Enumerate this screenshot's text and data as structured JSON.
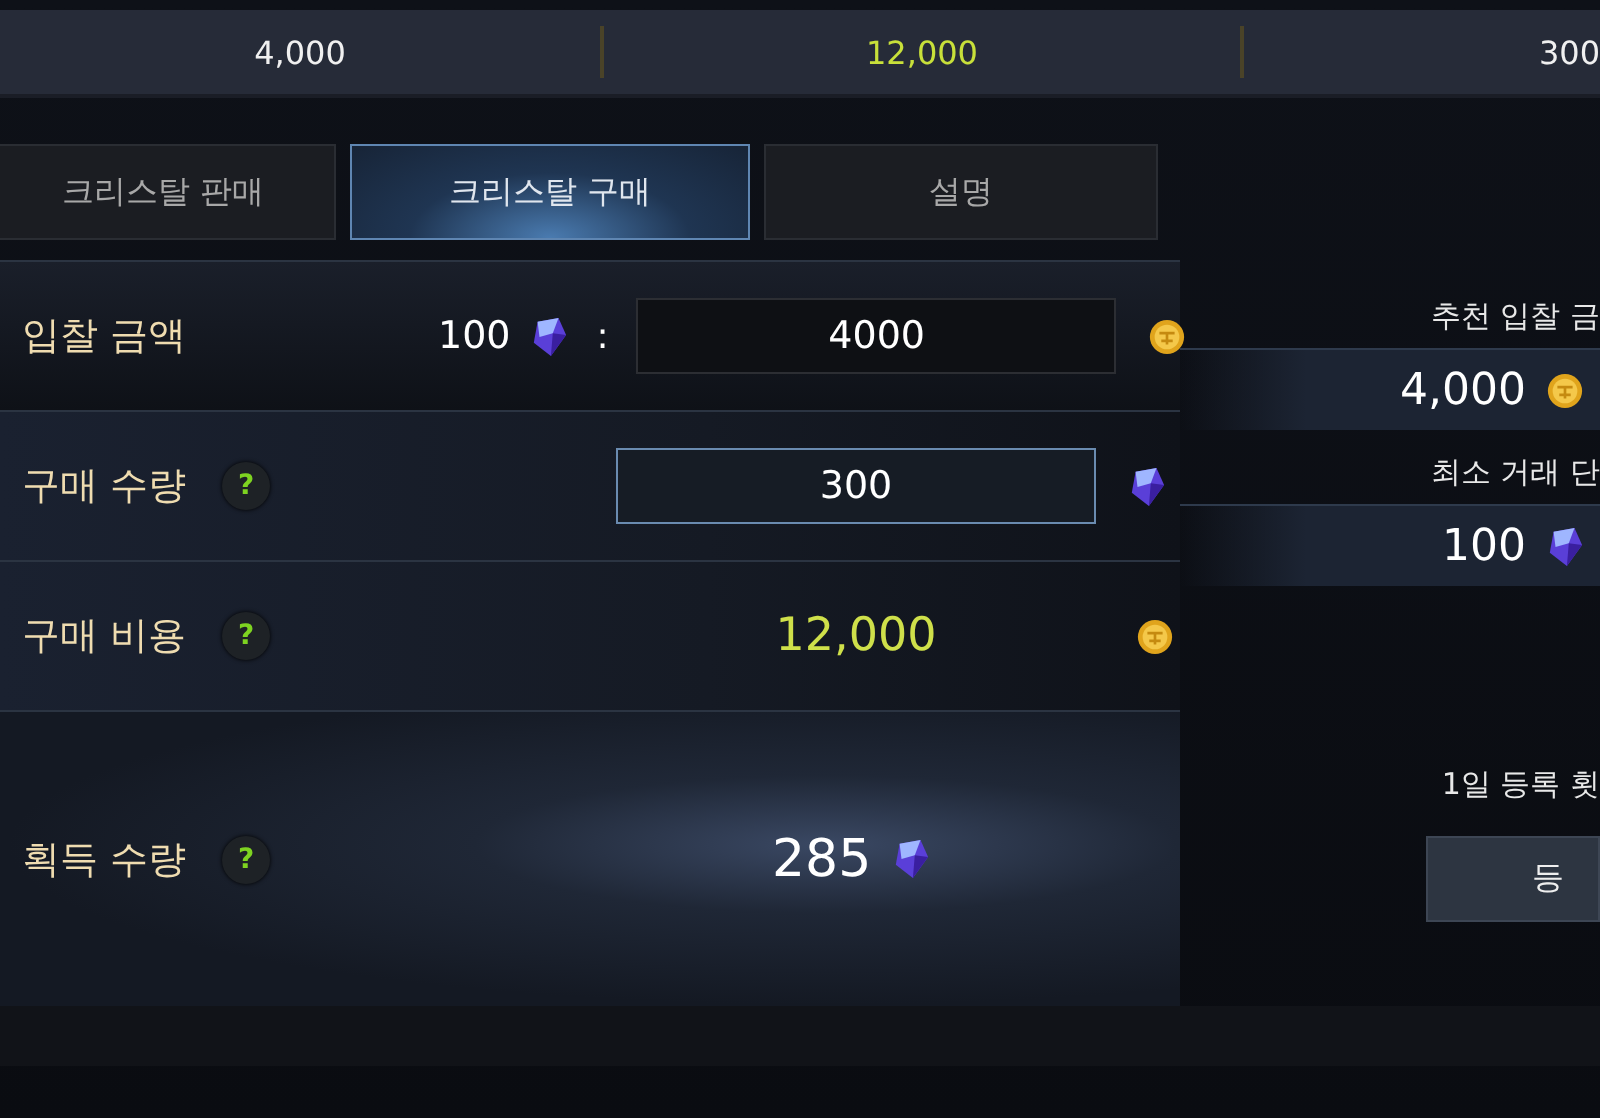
{
  "summary": [
    {
      "text": "4,000",
      "highlight": false
    },
    {
      "text": "12,000",
      "highlight": true
    },
    {
      "text": "300",
      "highlight": false
    }
  ],
  "tabs": [
    {
      "label": "크리스탈 판매",
      "selected": false
    },
    {
      "label": "크리스탈 구매",
      "selected": true
    },
    {
      "label": "설명",
      "selected": false
    }
  ],
  "rows": [
    {
      "kind": "rate",
      "label": "입찰 금액",
      "ratio_amount": "100",
      "separator": ":",
      "value": "4000",
      "focused": false
    },
    {
      "kind": "input",
      "label": "구매 수량",
      "help": "?",
      "value": "300",
      "focused": true
    },
    {
      "kind": "cost",
      "label": "구매 비용",
      "help": "?",
      "value": "12,000"
    },
    {
      "kind": "result",
      "label": "획득 수량",
      "help": "?",
      "value": "285"
    }
  ],
  "side": {
    "recommended_label": "추천 입찰 금",
    "recommended_value": "4,000",
    "min_unit_label": "최소 거래 단",
    "min_unit_value": "100",
    "daily_label": "1일 등록 횟",
    "register_button": "등"
  }
}
